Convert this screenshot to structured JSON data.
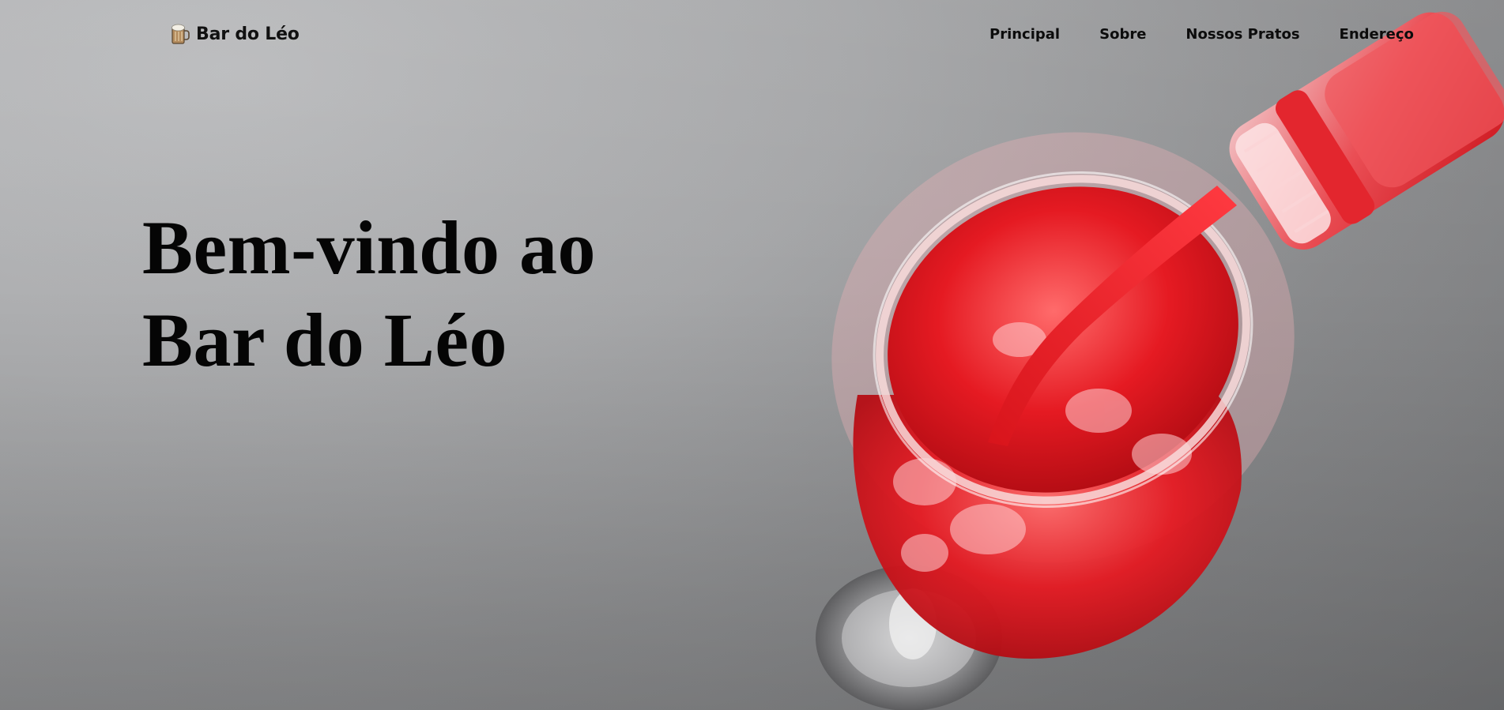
{
  "header": {
    "brand_name": "Bar do Léo",
    "brand_icon": "beer-mug-icon"
  },
  "nav": {
    "items": [
      {
        "label": "Principal"
      },
      {
        "label": "Sobre"
      },
      {
        "label": "Nossos Pratos"
      },
      {
        "label": "Endereço"
      }
    ]
  },
  "hero": {
    "title_line1": "Bem-vindo ao",
    "title_line2": "Bar do Léo",
    "image_subject": "red-drink-pouring-into-wine-glass-illustration"
  },
  "colors": {
    "background": "#a3a4a6",
    "text": "#0c0c0c",
    "drink_red": "#e01820"
  }
}
